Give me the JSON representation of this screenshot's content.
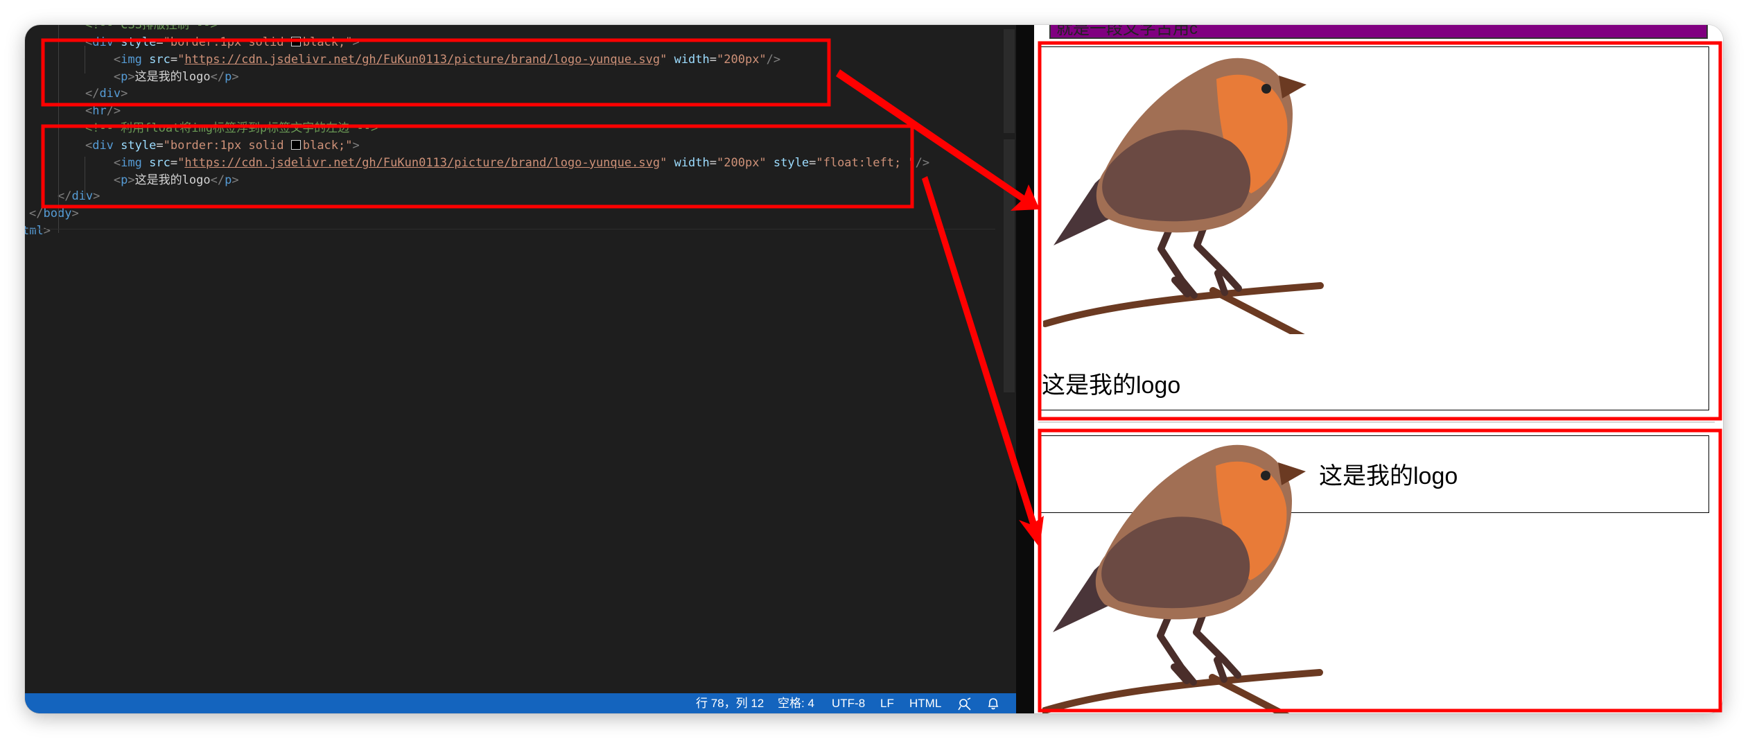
{
  "editor": {
    "lines": [
      {
        "indent": "    ",
        "tokens": [
          {
            "c": "com",
            "t": "<!-- CSS排版控制 -->"
          }
        ]
      },
      {
        "indent": "    ",
        "tokens": [
          {
            "c": "punct",
            "t": "<"
          },
          {
            "c": "tag",
            "t": "div"
          },
          {
            "c": "text",
            "t": " "
          },
          {
            "c": "attr",
            "t": "style"
          },
          {
            "c": "text",
            "t": "="
          },
          {
            "c": "str",
            "t": "\"border:1px solid "
          },
          {
            "c": "swatch",
            "t": ""
          },
          {
            "c": "str",
            "t": "black;\""
          },
          {
            "c": "punct",
            "t": ">"
          }
        ]
      },
      {
        "indent": "        ",
        "tokens": [
          {
            "c": "punct",
            "t": "<"
          },
          {
            "c": "tag",
            "t": "img"
          },
          {
            "c": "text",
            "t": " "
          },
          {
            "c": "attr",
            "t": "src"
          },
          {
            "c": "text",
            "t": "="
          },
          {
            "c": "str",
            "t": "\""
          },
          {
            "c": "url",
            "t": "https://cdn.jsdelivr.net/gh/FuKun0113/picture/brand/logo-yunque.svg"
          },
          {
            "c": "str",
            "t": "\""
          },
          {
            "c": "text",
            "t": " "
          },
          {
            "c": "attr",
            "t": "width"
          },
          {
            "c": "text",
            "t": "="
          },
          {
            "c": "str",
            "t": "\"200px\""
          },
          {
            "c": "punct",
            "t": "/>"
          }
        ]
      },
      {
        "indent": "        ",
        "tokens": [
          {
            "c": "punct",
            "t": "<"
          },
          {
            "c": "tag",
            "t": "p"
          },
          {
            "c": "punct",
            "t": ">"
          },
          {
            "c": "text",
            "t": "这是我的logo"
          },
          {
            "c": "punct",
            "t": "</"
          },
          {
            "c": "tag",
            "t": "p"
          },
          {
            "c": "punct",
            "t": ">"
          }
        ]
      },
      {
        "indent": "    ",
        "tokens": [
          {
            "c": "punct",
            "t": "</"
          },
          {
            "c": "tag",
            "t": "div"
          },
          {
            "c": "punct",
            "t": ">"
          }
        ]
      },
      {
        "indent": "    ",
        "tokens": [
          {
            "c": "punct",
            "t": "<"
          },
          {
            "c": "tag",
            "t": "hr"
          },
          {
            "c": "punct",
            "t": "/>"
          }
        ]
      },
      {
        "indent": "    ",
        "tokens": [
          {
            "c": "com",
            "t": "<!-- 利用float将img标签浮到p标签文字的左边 -->"
          }
        ]
      },
      {
        "indent": "    ",
        "tokens": [
          {
            "c": "punct",
            "t": "<"
          },
          {
            "c": "tag",
            "t": "div"
          },
          {
            "c": "text",
            "t": " "
          },
          {
            "c": "attr",
            "t": "style"
          },
          {
            "c": "text",
            "t": "="
          },
          {
            "c": "str",
            "t": "\"border:1px solid "
          },
          {
            "c": "swatch",
            "t": ""
          },
          {
            "c": "str",
            "t": "black;\""
          },
          {
            "c": "punct",
            "t": ">"
          }
        ]
      },
      {
        "indent": "        ",
        "tokens": [
          {
            "c": "punct",
            "t": "<"
          },
          {
            "c": "tag",
            "t": "img"
          },
          {
            "c": "text",
            "t": " "
          },
          {
            "c": "attr",
            "t": "src"
          },
          {
            "c": "text",
            "t": "="
          },
          {
            "c": "str",
            "t": "\""
          },
          {
            "c": "url",
            "t": "https://cdn.jsdelivr.net/gh/FuKun0113/picture/brand/logo-yunque.svg"
          },
          {
            "c": "str",
            "t": "\""
          },
          {
            "c": "text",
            "t": " "
          },
          {
            "c": "attr",
            "t": "width"
          },
          {
            "c": "text",
            "t": "="
          },
          {
            "c": "str",
            "t": "\"200px\""
          },
          {
            "c": "text",
            "t": " "
          },
          {
            "c": "attr",
            "t": "style"
          },
          {
            "c": "text",
            "t": "="
          },
          {
            "c": "str",
            "t": "\"float:left; \""
          },
          {
            "c": "punct",
            "t": "/>"
          }
        ]
      },
      {
        "indent": "        ",
        "tokens": [
          {
            "c": "punct",
            "t": "<"
          },
          {
            "c": "tag",
            "t": "p"
          },
          {
            "c": "punct",
            "t": ">"
          },
          {
            "c": "text",
            "t": "这是我的logo"
          },
          {
            "c": "punct",
            "t": "</"
          },
          {
            "c": "tag",
            "t": "p"
          },
          {
            "c": "punct",
            "t": ">"
          }
        ]
      },
      {
        "indent": "    ",
        "tokens": [
          {
            "c": "punct",
            "t": "</"
          },
          {
            "c": "tag",
            "t": "div"
          },
          {
            "c": "punct",
            "t": ">"
          }
        ]
      },
      {
        "indent": "",
        "tokens": [
          {
            "c": "punct",
            "t": "</"
          },
          {
            "c": "tag",
            "t": "body"
          },
          {
            "c": "punct",
            "t": ">"
          }
        ]
      },
      {
        "indent": "",
        "tokens": [
          {
            "c": "tag",
            "t": "tml"
          },
          {
            "c": "punct",
            "t": ">"
          }
        ]
      }
    ]
  },
  "statusbar": {
    "position": "行 78，列 12",
    "spaces": "空格: 4",
    "encoding": "UTF-8",
    "eol": "LF",
    "language": "HTML"
  },
  "preview": {
    "top_bar_text": "就是一段文字占用c",
    "demo1_text": "这是我的logo",
    "demo2_text": "这是我的logo"
  },
  "colors": {
    "highlight": "#ff0000",
    "statusbar": "#1464be",
    "purple": "#800080"
  }
}
